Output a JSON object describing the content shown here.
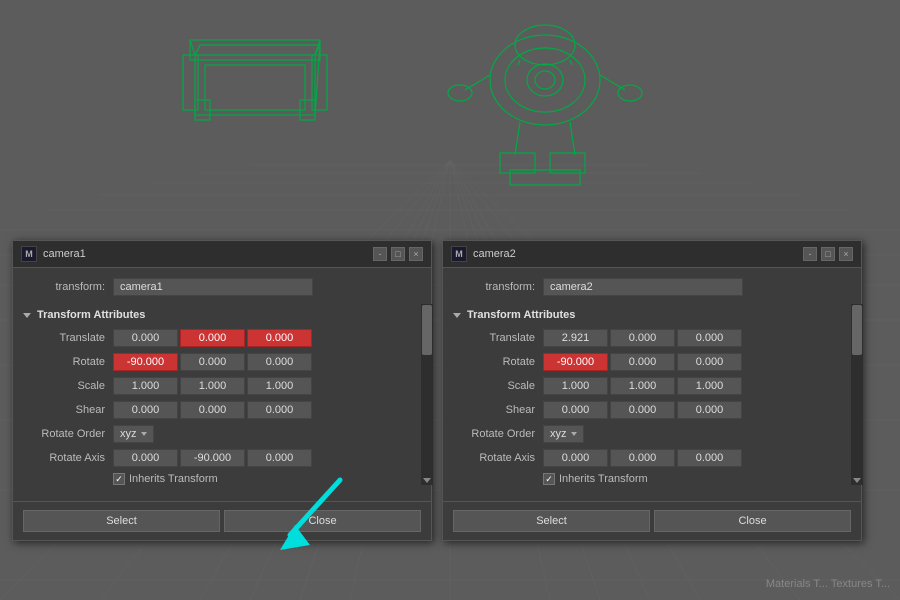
{
  "viewport": {
    "corner_text": "Materials T... Textures T..."
  },
  "dialog1": {
    "title": "camera1",
    "logo": "M",
    "transform_label": "transform:",
    "transform_value": "camera1",
    "section_title": "Transform Attributes",
    "translate_label": "Translate",
    "translate_x": "0.000",
    "translate_y": "0.000",
    "translate_z": "0.000",
    "rotate_label": "Rotate",
    "rotate_x": "-90.000",
    "rotate_y": "0.000",
    "rotate_z": "0.000",
    "scale_label": "Scale",
    "scale_x": "1.000",
    "scale_y": "1.000",
    "scale_z": "1.000",
    "shear_label": "Shear",
    "shear_x": "0.000",
    "shear_y": "0.000",
    "shear_z": "0.000",
    "rotate_order_label": "Rotate Order",
    "rotate_order_value": "xyz",
    "rotate_axis_label": "Rotate Axis",
    "rotate_axis_x": "0.000",
    "rotate_axis_y": "-90.000",
    "rotate_axis_z": "0.000",
    "inherits_transform": "Inherits Transform",
    "select_btn": "Select",
    "close_btn": "Close",
    "min_btn": "-",
    "max_btn": "□",
    "x_btn": "×"
  },
  "dialog2": {
    "title": "camera2",
    "logo": "M",
    "transform_label": "transform:",
    "transform_value": "camera2",
    "section_title": "Transform Attributes",
    "translate_label": "Translate",
    "translate_x": "2.921",
    "translate_y": "0.000",
    "translate_z": "0.000",
    "rotate_label": "Rotate",
    "rotate_x": "-90.000",
    "rotate_y": "0.000",
    "rotate_z": "0.000",
    "scale_label": "Scale",
    "scale_x": "1.000",
    "scale_y": "1.000",
    "scale_z": "1.000",
    "shear_label": "Shear",
    "shear_x": "0.000",
    "shear_y": "0.000",
    "shear_z": "0.000",
    "rotate_order_label": "Rotate Order",
    "rotate_order_value": "xyz",
    "rotate_axis_label": "Rotate Axis",
    "rotate_axis_x": "0.000",
    "rotate_axis_y": "0.000",
    "rotate_axis_z": "0.000",
    "inherits_transform": "Inherits Transform",
    "select_btn": "Select",
    "close_btn": "Close",
    "min_btn": "-",
    "max_btn": "□",
    "x_btn": "×"
  }
}
